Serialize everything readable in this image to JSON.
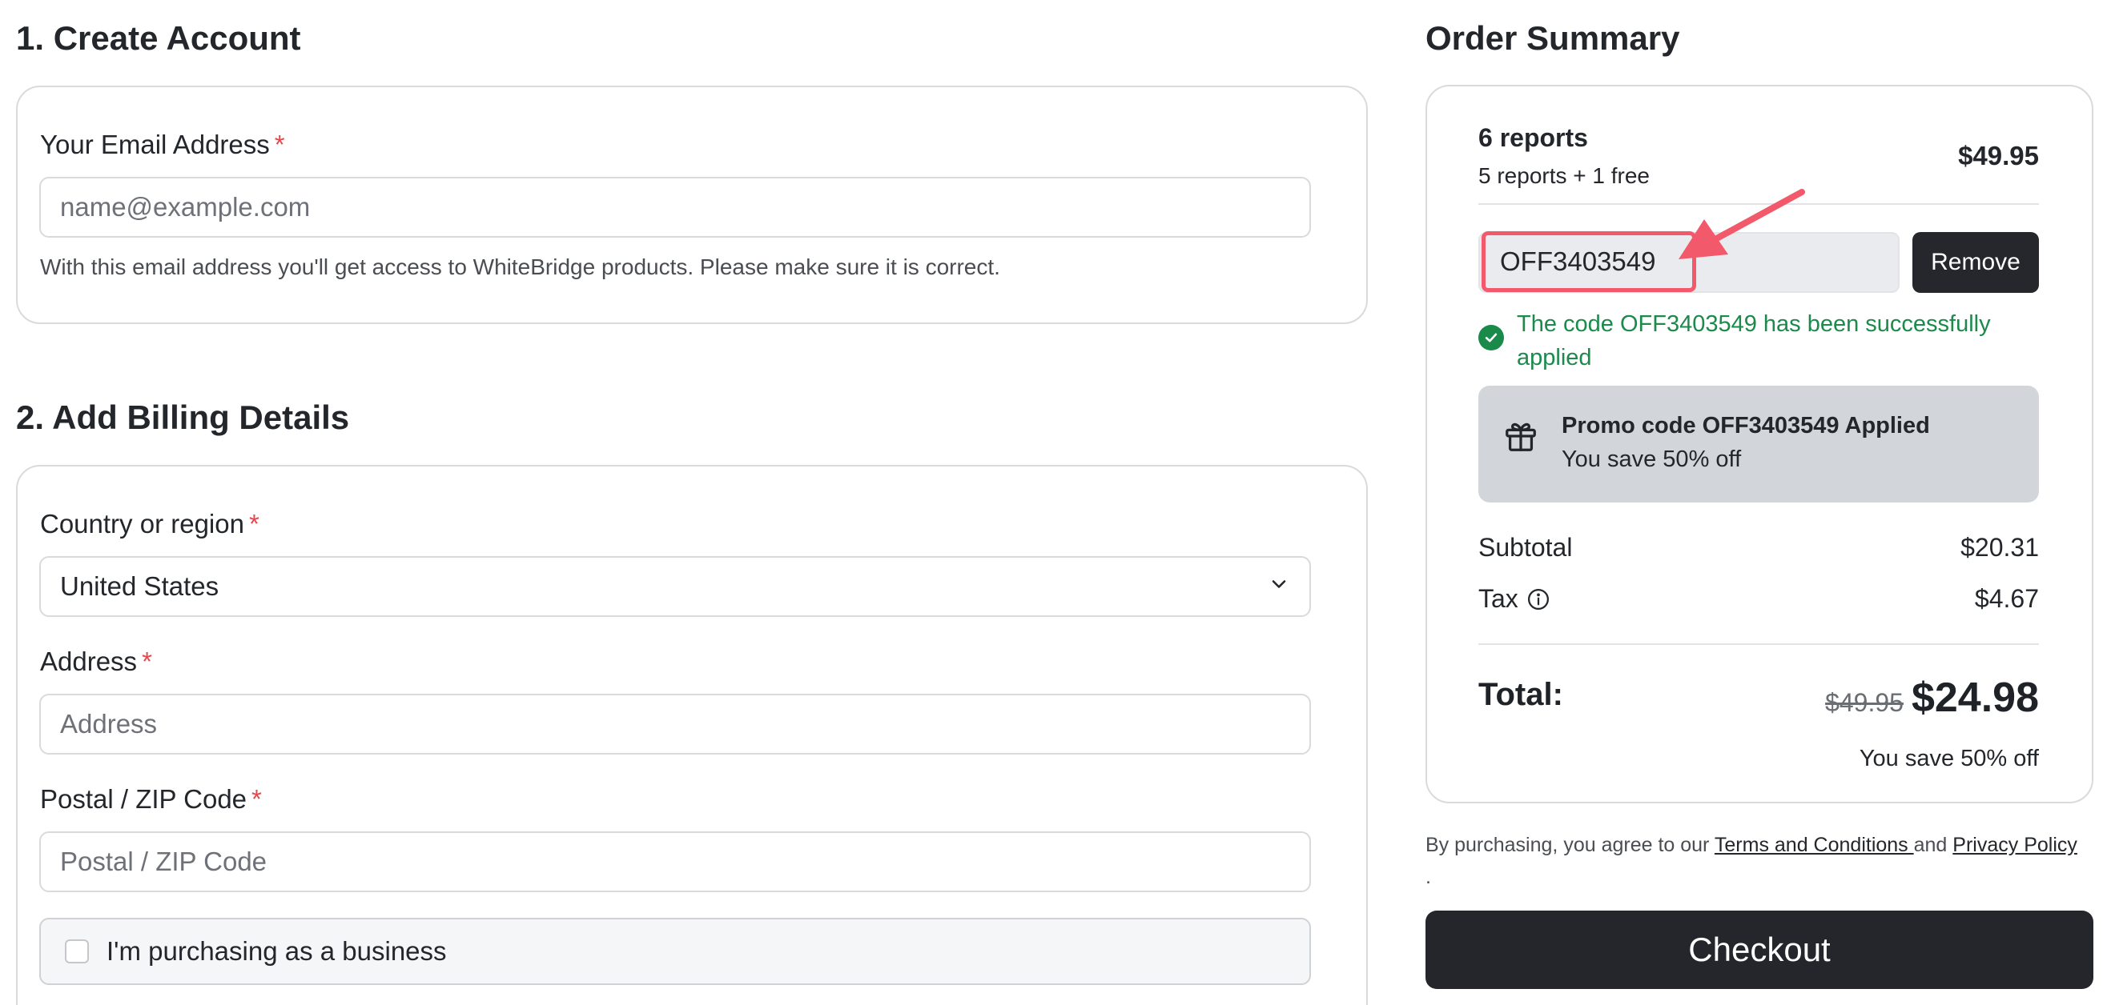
{
  "account": {
    "heading": "1. Create Account",
    "email_label": "Your Email Address",
    "required_mark": "*",
    "email_placeholder": "name@example.com",
    "email_value": "",
    "email_hint": "With this email address you'll get access to WhiteBridge products. Please make sure it is correct."
  },
  "billing": {
    "heading": "2. Add Billing Details",
    "country_label": "Country or region",
    "country_value": "United States",
    "address_label": "Address",
    "address_placeholder": "Address",
    "zip_label": "Postal / ZIP Code",
    "zip_placeholder": "Postal / ZIP Code",
    "business_label": "I'm purchasing as a business",
    "business_checked": false
  },
  "summary": {
    "heading": "Order Summary",
    "product_name": "6 reports",
    "product_detail": "5 reports + 1 free",
    "product_price": "$49.95",
    "promo_code": "OFF3403549",
    "remove_label": "Remove",
    "success_message": "The code OFF3403549 has been successfully applied",
    "promo_applied_title": "Promo code OFF3403549 Applied",
    "promo_applied_saving": "You save 50% off",
    "subtotal_label": "Subtotal",
    "subtotal_value": "$20.31",
    "tax_label": "Tax",
    "tax_value": "$4.67",
    "total_label": "Total:",
    "total_original": "$49.95",
    "total_value": "$24.98",
    "total_saving": "You save 50% off"
  },
  "legal": {
    "prefix": "By purchasing, you agree to our ",
    "terms": "Terms and Conditions ",
    "and": "and ",
    "privacy": "Privacy Policy",
    "suffix": "."
  },
  "checkout_label": "Checkout",
  "colors": {
    "accent_dark": "#24262b",
    "success": "#1b8a4b",
    "annotation": "#f2596b",
    "required": "#e5484d"
  }
}
